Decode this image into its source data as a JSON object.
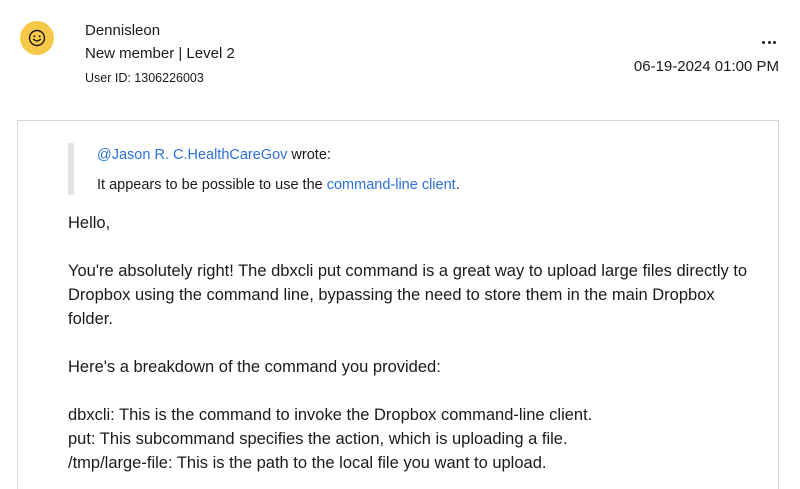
{
  "author": {
    "name": "Dennisleon",
    "rank": "New member | Level 2",
    "user_id": "User ID: 1306226003",
    "avatar_icon": "smiley-face-icon",
    "avatar_color": "#f7c948"
  },
  "post": {
    "date": "06-19-2024 01:00 PM",
    "menu_icon": "more-options-icon"
  },
  "quote": {
    "mention": "@Jason R. C.HealthCareGov",
    "wrote": " wrote:",
    "text_before": "It appears to be possible to use the ",
    "link_text": "command-line client",
    "text_after": ".",
    "link_color": "#2b70d8"
  },
  "message": {
    "greeting": "Hello,",
    "para1": "You're absolutely right! The dbxcli put command is a great way to upload large files directly to Dropbox using the command line, bypassing the need to store them in the main Dropbox folder.",
    "para2": "Here's a breakdown of the command you provided:",
    "line1": "dbxcli: This is the command to invoke the Dropbox command-line client.",
    "line2": "put: This subcommand specifies the action, which is uploading a file.",
    "line3": "/tmp/large-file: This is the path to the local file you want to upload."
  }
}
